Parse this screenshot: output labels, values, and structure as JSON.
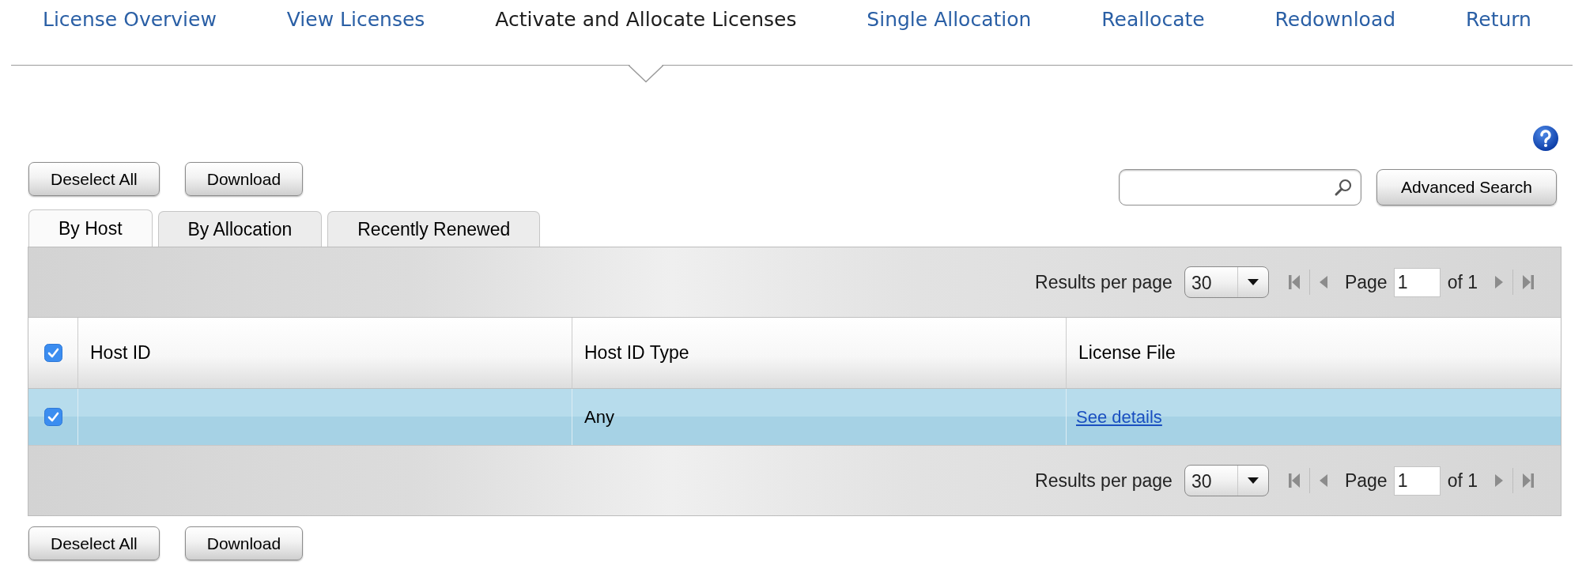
{
  "nav": [
    {
      "label": "License Overview",
      "selected": false
    },
    {
      "label": "View Licenses",
      "selected": false
    },
    {
      "label": "Activate and Allocate Licenses",
      "selected": true
    },
    {
      "label": "Single Allocation",
      "selected": false
    },
    {
      "label": "Reallocate",
      "selected": false
    },
    {
      "label": "Redownload",
      "selected": false
    },
    {
      "label": "Return",
      "selected": false
    }
  ],
  "top_buttons": [
    "Deselect All",
    "Download"
  ],
  "search": {
    "button": "Advanced Search"
  },
  "tabs": [
    {
      "label": "By Host",
      "selected": true
    },
    {
      "label": "By Allocation",
      "selected": false
    },
    {
      "label": "Recently Renewed",
      "selected": false
    }
  ],
  "table": {
    "pager_top": {
      "per_page_label": "Results per page",
      "per_page": "30",
      "page_label": "Page",
      "page": "1",
      "page_count": "of 1"
    },
    "select_all": {
      "checked": true
    },
    "columns": [
      "Host ID",
      "Host ID Type",
      "License File"
    ],
    "rows": [
      {
        "checked": true,
        "host_id_type": "Any",
        "license_file": "See details"
      }
    ],
    "pager_bottom": {
      "per_page_label": "Results per page",
      "per_page": "30",
      "page_label": "Page",
      "page": "1",
      "page_count": "of 1"
    }
  },
  "bottom_buttons": [
    "Deselect All",
    "Download"
  ]
}
